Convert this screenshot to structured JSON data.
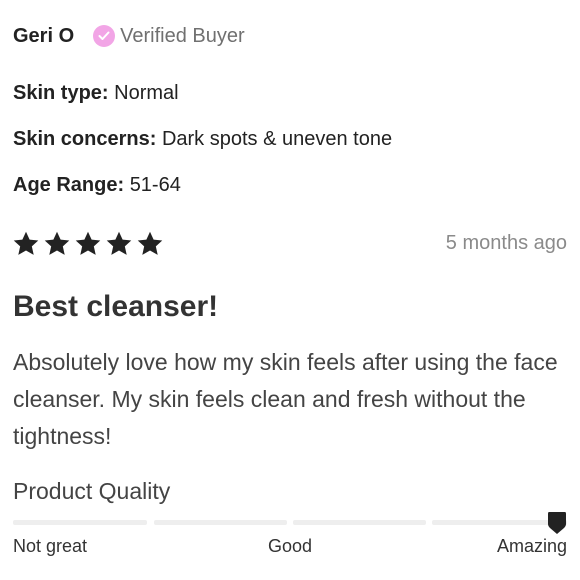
{
  "reviewer": {
    "name": "Geri O",
    "verified_label": "Verified Buyer",
    "verified_icon": "check-circle-icon",
    "verified_color": "#F2A5E6"
  },
  "attributes": [
    {
      "key": "Skin type:",
      "value": "Normal"
    },
    {
      "key": "Skin concerns:",
      "value": "Dark spots & uneven tone"
    },
    {
      "key": "Age Range:",
      "value": "51-64"
    }
  ],
  "rating": {
    "stars": 5,
    "max": 5,
    "star_color": "#222222",
    "date": "5 months ago"
  },
  "review": {
    "title": "Best cleanser!",
    "body": "Absolutely love how my skin feels after using the face cleanser. My skin feels clean and fresh without the tightness!"
  },
  "quality": {
    "label": "Product Quality",
    "value_fraction": 1.0,
    "scale_labels": {
      "low": "Not great",
      "mid": "Good",
      "high": "Amazing"
    }
  }
}
